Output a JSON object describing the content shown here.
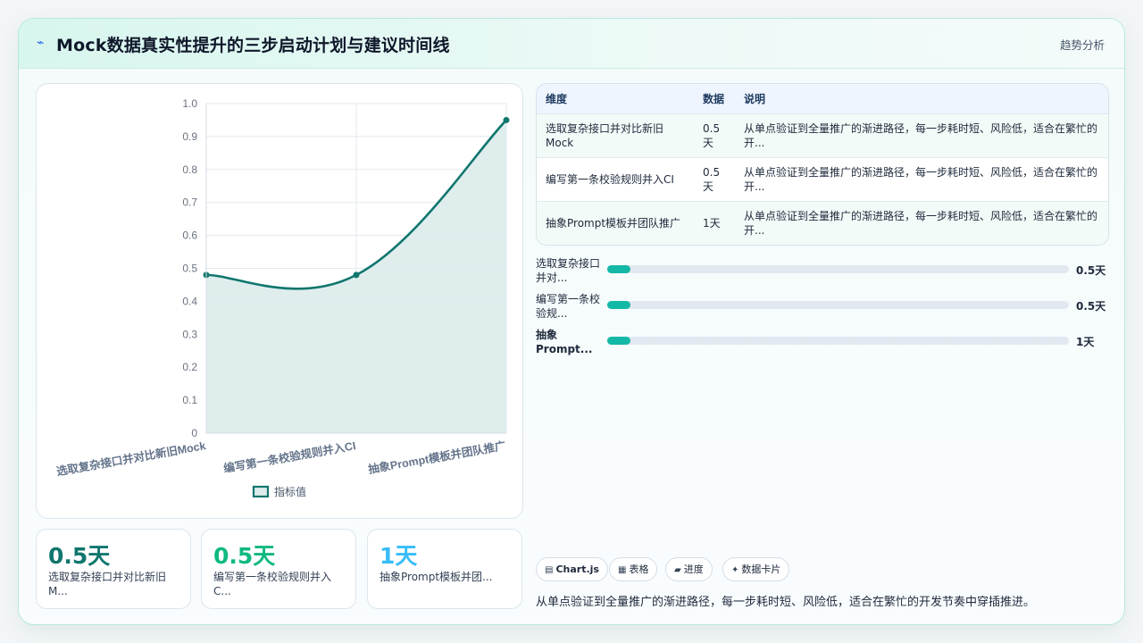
{
  "header": {
    "logo_icon": "wave-icon",
    "title": "Mock数据真实性提升的三步启动计划与建议时间线",
    "tag": "趋势分析"
  },
  "chart_data": {
    "type": "line",
    "fill": true,
    "curve": "smooth",
    "categories": [
      "选取复杂接口并对比新旧Mock",
      "编写第一条校验规则并入CI",
      "抽象Prompt模板并团队推广"
    ],
    "series": [
      {
        "name": "指标值",
        "values": [
          0.48,
          0.48,
          0.95
        ]
      }
    ],
    "ylim": [
      0,
      1.0
    ],
    "yticks": [
      "0",
      "0.1",
      "0.2",
      "0.3",
      "0.4",
      "0.5",
      "0.6",
      "0.7",
      "0.8",
      "0.9",
      "1.0"
    ],
    "grid": true,
    "legend": "bottom",
    "line_color": "#0f766e",
    "fill_color": "#dcebeb"
  },
  "table": {
    "headers": [
      "维度",
      "数据",
      "说明"
    ],
    "rows": [
      [
        "选取复杂接口并对比新旧Mock",
        "0.5天",
        "从单点验证到全量推广的渐进路径，每一步耗时短、风险低，适合在繁忙的开..."
      ],
      [
        "编写第一条校验规则并入CI",
        "0.5天",
        "从单点验证到全量推广的渐进路径，每一步耗时短、风险低，适合在繁忙的开..."
      ],
      [
        "抽象Prompt模板并团队推广",
        "1天",
        "从单点验证到全量推广的渐进路径，每一步耗时短、风险低，适合在繁忙的开..."
      ]
    ]
  },
  "progress": [
    {
      "label": "选取复杂接口并对...",
      "value": "0.5天",
      "fraction": 0.05
    },
    {
      "label": "编写第一条校验规...",
      "value": "0.5天",
      "fraction": 0.05
    },
    {
      "label": "抽象Prompt...",
      "value": "1天",
      "fraction": 0.05
    }
  ],
  "kpis": [
    {
      "value": "0.5天",
      "label": "选取复杂接口并对比新旧M...",
      "color": "#0f766e"
    },
    {
      "value": "0.5天",
      "label": "编写第一条校验规则并入C...",
      "color": "#10b981"
    },
    {
      "value": "1天",
      "label": "抽象Prompt模板并团...",
      "color": "#38bdf8"
    }
  ],
  "chips": [
    {
      "icon": "chart-icon",
      "glyph": "▤",
      "label": "Chart.js"
    },
    {
      "icon": "table-icon",
      "glyph": "▦",
      "label": "表格"
    },
    {
      "icon": "progress-icon",
      "glyph": "▰",
      "label": "进度"
    },
    {
      "icon": "sparkle-icon",
      "glyph": "✦",
      "label": "数据卡片"
    }
  ],
  "summary": "从单点验证到全量推广的渐进路径，每一步耗时短、风险低，适合在繁忙的开发节奏中穿插推进。"
}
